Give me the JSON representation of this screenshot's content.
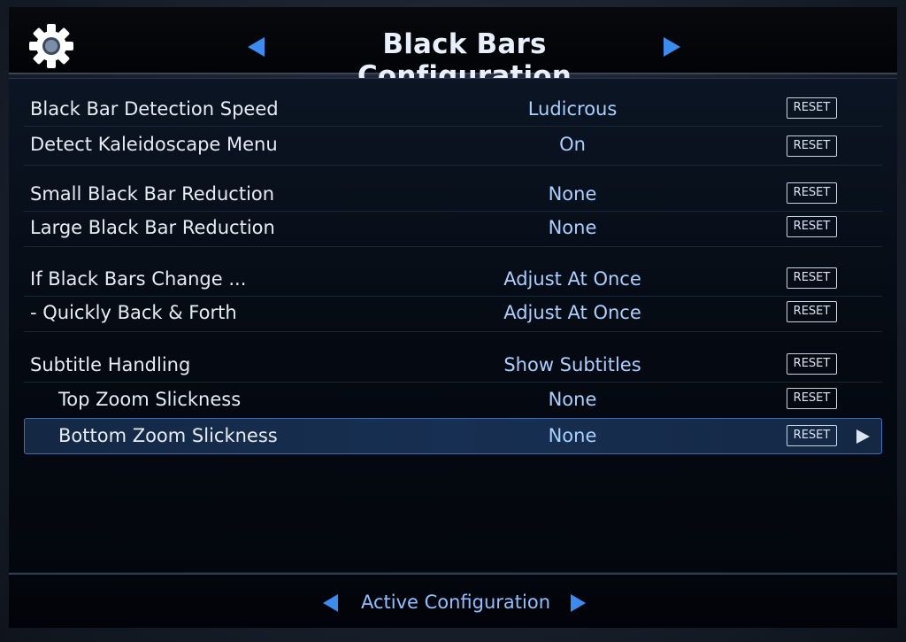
{
  "header": {
    "title": "Black Bars Configuration",
    "settings_icon": "gear-icon",
    "prev_icon": "triangle-left-icon",
    "next_icon": "triangle-right-icon"
  },
  "settings": [
    {
      "label": "Black Bar Detection Speed",
      "value": "Ludicrous",
      "reset": "RESET"
    },
    {
      "label": "Detect Kaleidoscape Menu",
      "value": "On",
      "reset": "RESET"
    },
    {
      "label": "Small Black Bar Reduction",
      "value": "None",
      "reset": "RESET"
    },
    {
      "label": "Large Black Bar Reduction",
      "value": "None",
      "reset": "RESET"
    },
    {
      "label": "If Black Bars Change ...",
      "value": "Adjust At Once",
      "reset": "RESET"
    },
    {
      "label": "- Quickly Back & Forth",
      "value": "Adjust At Once",
      "reset": "RESET"
    },
    {
      "label": "Subtitle Handling",
      "value": "Show Subtitles",
      "reset": "RESET"
    },
    {
      "label": "Top Zoom Slickness",
      "value": "None",
      "reset": "RESET"
    },
    {
      "label": "Bottom Zoom Slickness",
      "value": "None",
      "reset": "RESET",
      "selected": true
    }
  ],
  "footer": {
    "label": "Active Configuration"
  },
  "colors": {
    "accent": "#3b8cf0",
    "value_text": "#a9d0ff",
    "label_text": "#e6ecf4",
    "selected_border": "#3a6fb8"
  }
}
